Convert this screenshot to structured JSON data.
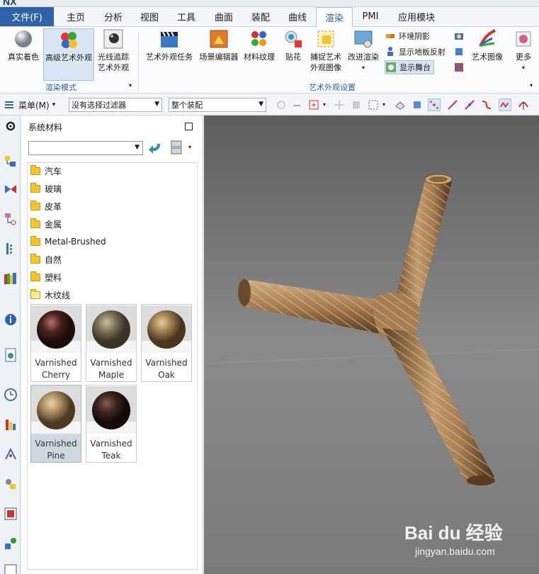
{
  "app": {
    "logo": "NX"
  },
  "tabs": {
    "file": "文件(F)",
    "items": [
      "主页",
      "分析",
      "视图",
      "工具",
      "曲面",
      "装配",
      "曲线",
      "渲染",
      "PMI",
      "应用模块"
    ],
    "active": "渲染"
  },
  "ribbon": {
    "render_mode": {
      "true_shading": "真实着色",
      "advanced_studio": "高级艺术外观",
      "ray_traced": [
        "光线追踪",
        "艺术外观"
      ],
      "group_label": "渲染模式"
    },
    "studio_setup": {
      "studio_task": "艺术外观任务",
      "scene_editor": "场景编辑器",
      "material_texture": "材料纹理",
      "decal": "贴花",
      "capture": [
        "捕捉艺术",
        "外观图像"
      ],
      "progressive": "改进渲染",
      "env_shadow": "环境阴影",
      "floor_reflection": "显示地板反射",
      "show_stage": "显示舞台",
      "art_image": "艺术图像",
      "more": "更多",
      "group_label": "艺术外观设置"
    }
  },
  "selection_bar": {
    "menu": "菜单(M)",
    "filter": "没有选择过滤器",
    "scope": "整个装配"
  },
  "material_panel": {
    "title": "系统材料",
    "folders": [
      "汽车",
      "玻璃",
      "皮革",
      "金属",
      "Metal-Brushed",
      "自然",
      "塑料",
      "木纹线"
    ],
    "materials": [
      {
        "line1": "Varnished",
        "line2": "Cherry",
        "color": "#4a2222"
      },
      {
        "line1": "Varnished",
        "line2": "Maple",
        "color": "#7a6e56"
      },
      {
        "line1": "Varnished",
        "line2": "Oak",
        "color": "#9c7d52"
      },
      {
        "line1": "Varnished",
        "line2": "Pine",
        "color": "#a98a60"
      },
      {
        "line1": "Varnished",
        "line2": "Teak",
        "color": "#3a2320"
      }
    ]
  },
  "watermark": {
    "brand": "Bai du 经验",
    "url": "jingyan.baidu.com"
  }
}
